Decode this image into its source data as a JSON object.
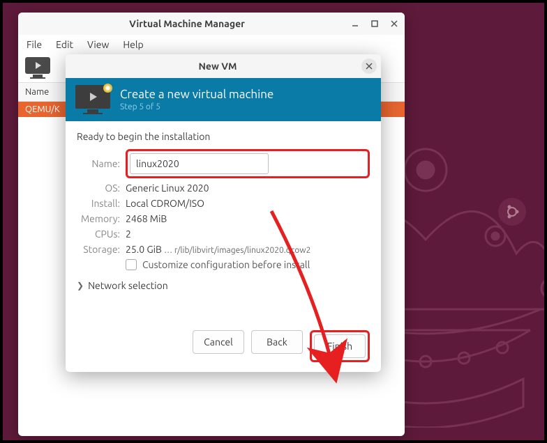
{
  "main_window": {
    "title": "Virtual Machine Manager",
    "menu": {
      "file": "File",
      "edit": "Edit",
      "view": "View",
      "help": "Help"
    },
    "table_header": "Name",
    "vm_row": "QEMU/K"
  },
  "dialog": {
    "title": "New VM",
    "header_title": "Create a new virtual machine",
    "step": "Step 5 of 5",
    "ready_text": "Ready to begin the installation",
    "labels": {
      "name": "Name:",
      "os": "OS:",
      "install": "Install:",
      "memory": "Memory:",
      "cpus": "CPUs:",
      "storage": "Storage:"
    },
    "values": {
      "name": "linux2020",
      "os": "Generic Linux 2020",
      "install": "Local CDROM/ISO",
      "memory": "2468 MiB",
      "cpus": "2",
      "storage_size": "25.0 GiB",
      "storage_path": "… r/lib/libvirt/images/linux2020.qcow2"
    },
    "customize_label": "Customize configuration before install",
    "network_label": "Network selection",
    "buttons": {
      "cancel": "Cancel",
      "back": "Back",
      "finish": "Finish"
    }
  }
}
